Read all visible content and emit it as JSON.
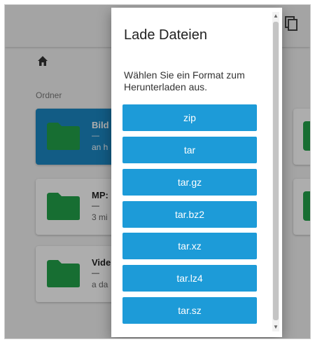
{
  "background": {
    "section_label": "Ordner",
    "folders": [
      {
        "name": "Bild",
        "dash": "—",
        "meta": "an h",
        "selected": true
      },
      {
        "name": "MP:",
        "dash": "—",
        "meta": "3 mi",
        "selected": false
      },
      {
        "name": "Vide",
        "dash": "—",
        "meta": "a da",
        "selected": false
      }
    ]
  },
  "dialog": {
    "title": "Lade Dateien",
    "message": "Wählen Sie ein Format zum Herunterladen aus.",
    "formats": [
      "zip",
      "tar",
      "tar.gz",
      "tar.bz2",
      "tar.xz",
      "tar.lz4",
      "tar.sz"
    ]
  },
  "colors": {
    "accent": "#1d9bd8",
    "selected_card": "#1b88c4",
    "folder": "#22a24a"
  },
  "icons": [
    "copy-icon",
    "home-icon",
    "folder-icon"
  ]
}
